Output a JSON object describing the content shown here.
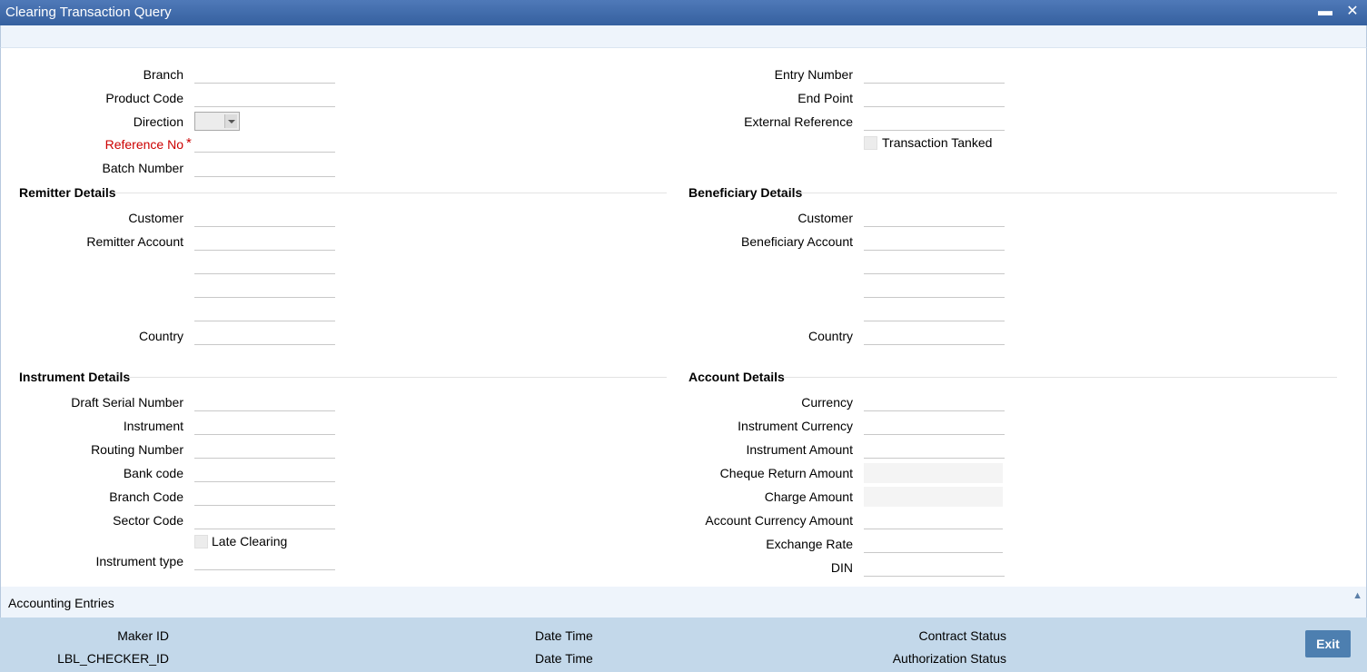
{
  "window": {
    "title": "Clearing Transaction Query",
    "minimize_icon": "minimize-icon",
    "close_icon": "close-icon"
  },
  "left": {
    "branch": "Branch",
    "product_code": "Product Code",
    "direction": "Direction",
    "direction_value": "",
    "reference_no": "Reference No",
    "required_mark": "*",
    "batch_number": "Batch Number"
  },
  "right": {
    "entry_number": "Entry Number",
    "end_point": "End Point",
    "external_reference": "External Reference",
    "transaction_tanked": "Transaction Tanked"
  },
  "remitter": {
    "heading": "Remitter Details",
    "customer": "Customer",
    "account": "Remitter Account",
    "country": "Country"
  },
  "beneficiary": {
    "heading": "Beneficiary Details",
    "customer": "Customer",
    "account": "Beneficiary Account",
    "country": "Country"
  },
  "instrument": {
    "heading": "Instrument Details",
    "draft_serial": "Draft Serial Number",
    "instrument": "Instrument",
    "routing": "Routing Number",
    "bank_code": "Bank code",
    "branch_code": "Branch Code",
    "sector_code": "Sector Code",
    "late_clearing": "Late Clearing",
    "instrument_type": "Instrument type"
  },
  "account": {
    "heading": "Account Details",
    "currency": "Currency",
    "instrument_currency": "Instrument Currency",
    "instrument_amount": "Instrument Amount",
    "cheque_return": "Cheque Return Amount",
    "charge_amount": "Charge Amount",
    "account_currency_amount": "Account Currency Amount",
    "exchange_rate": "Exchange Rate",
    "din": "DIN"
  },
  "accounting": {
    "label": "Accounting Entries"
  },
  "footer": {
    "maker_id": "Maker ID",
    "checker_id": "LBL_CHECKER_ID",
    "date_time_1": "Date Time",
    "date_time_2": "Date Time",
    "contract_status": "Contract Status",
    "authorization_status": "Authorization Status",
    "exit": "Exit"
  }
}
